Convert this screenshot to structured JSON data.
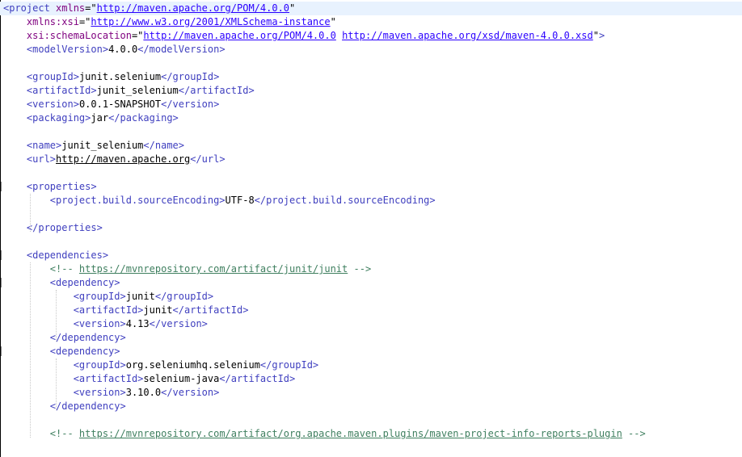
{
  "editor": {
    "colors": {
      "background": "#ffffff",
      "tag": "#3f3fbf",
      "attribute": "#7f007f",
      "attribute_value": "#2a00ff",
      "comment": "#3f7f5f",
      "current_line": "#e8f2fe"
    },
    "lines": [
      [
        {
          "t": "tag",
          "v": "<project"
        },
        {
          "t": "text",
          "v": " "
        },
        {
          "t": "attr",
          "v": "xmlns"
        },
        {
          "t": "punct",
          "v": "=\""
        },
        {
          "t": "url",
          "v": "http://maven.apache.org/POM/4.0.0"
        },
        {
          "t": "punct",
          "v": "\""
        }
      ],
      [
        {
          "t": "text",
          "v": "    "
        },
        {
          "t": "attr",
          "v": "xmlns:xsi"
        },
        {
          "t": "punct",
          "v": "=\""
        },
        {
          "t": "url",
          "v": "http://www.w3.org/2001/XMLSchema-instance"
        },
        {
          "t": "punct",
          "v": "\""
        }
      ],
      [
        {
          "t": "text",
          "v": "    "
        },
        {
          "t": "attr",
          "v": "xsi:schemaLocation"
        },
        {
          "t": "punct",
          "v": "=\""
        },
        {
          "t": "url",
          "v": "http://maven.apache.org/POM/4.0.0"
        },
        {
          "t": "text",
          "v": " "
        },
        {
          "t": "url",
          "v": "http://maven.apache.org/xsd/maven-4.0.0.xsd"
        },
        {
          "t": "punct",
          "v": "\""
        },
        {
          "t": "tag",
          "v": ">"
        }
      ],
      [
        {
          "t": "text",
          "v": "    "
        },
        {
          "t": "tag",
          "v": "<modelVersion>"
        },
        {
          "t": "text",
          "v": "4.0.0"
        },
        {
          "t": "tag",
          "v": "</modelVersion>"
        }
      ],
      [],
      [
        {
          "t": "text",
          "v": "    "
        },
        {
          "t": "tag",
          "v": "<groupId>"
        },
        {
          "t": "text",
          "v": "junit.selenium"
        },
        {
          "t": "tag",
          "v": "</groupId>"
        }
      ],
      [
        {
          "t": "text",
          "v": "    "
        },
        {
          "t": "tag",
          "v": "<artifactId>"
        },
        {
          "t": "text",
          "v": "junit_selenium"
        },
        {
          "t": "tag",
          "v": "</artifactId>"
        }
      ],
      [
        {
          "t": "text",
          "v": "    "
        },
        {
          "t": "tag",
          "v": "<version>"
        },
        {
          "t": "text",
          "v": "0.0.1-SNAPSHOT"
        },
        {
          "t": "tag",
          "v": "</version>"
        }
      ],
      [
        {
          "t": "text",
          "v": "    "
        },
        {
          "t": "tag",
          "v": "<packaging>"
        },
        {
          "t": "text",
          "v": "jar"
        },
        {
          "t": "tag",
          "v": "</packaging>"
        }
      ],
      [],
      [
        {
          "t": "text",
          "v": "    "
        },
        {
          "t": "tag",
          "v": "<name>"
        },
        {
          "t": "text",
          "v": "junit_selenium"
        },
        {
          "t": "tag",
          "v": "</name>"
        }
      ],
      [
        {
          "t": "text",
          "v": "    "
        },
        {
          "t": "tag",
          "v": "<url>"
        },
        {
          "t": "link",
          "v": "http://maven.apache.org"
        },
        {
          "t": "tag",
          "v": "</url>"
        }
      ],
      [],
      [
        {
          "t": "text",
          "v": "    "
        },
        {
          "t": "tag",
          "v": "<properties>"
        }
      ],
      [
        {
          "t": "text",
          "v": "        "
        },
        {
          "t": "tag",
          "v": "<project.build.sourceEncoding>"
        },
        {
          "t": "text",
          "v": "UTF-8"
        },
        {
          "t": "tag",
          "v": "</project.build.sourceEncoding>"
        }
      ],
      [],
      [
        {
          "t": "text",
          "v": "    "
        },
        {
          "t": "tag",
          "v": "</properties>"
        }
      ],
      [],
      [
        {
          "t": "text",
          "v": "    "
        },
        {
          "t": "tag",
          "v": "<dependencies>"
        }
      ],
      [
        {
          "t": "text",
          "v": "        "
        },
        {
          "t": "comment",
          "v": "<!-- "
        },
        {
          "t": "comment_link",
          "v": "https://mvnrepository.com/artifact/junit/junit"
        },
        {
          "t": "comment",
          "v": " -->"
        }
      ],
      [
        {
          "t": "text",
          "v": "        "
        },
        {
          "t": "tag",
          "v": "<dependency>"
        }
      ],
      [
        {
          "t": "text",
          "v": "            "
        },
        {
          "t": "tag",
          "v": "<groupId>"
        },
        {
          "t": "text",
          "v": "junit"
        },
        {
          "t": "tag",
          "v": "</groupId>"
        }
      ],
      [
        {
          "t": "text",
          "v": "            "
        },
        {
          "t": "tag",
          "v": "<artifactId>"
        },
        {
          "t": "text",
          "v": "junit"
        },
        {
          "t": "tag",
          "v": "</artifactId>"
        }
      ],
      [
        {
          "t": "text",
          "v": "            "
        },
        {
          "t": "tag",
          "v": "<version>"
        },
        {
          "t": "text",
          "v": "4.13"
        },
        {
          "t": "tag",
          "v": "</version>"
        }
      ],
      [
        {
          "t": "text",
          "v": "        "
        },
        {
          "t": "tag",
          "v": "</dependency>"
        }
      ],
      [
        {
          "t": "text",
          "v": "        "
        },
        {
          "t": "tag",
          "v": "<dependency>"
        }
      ],
      [
        {
          "t": "text",
          "v": "            "
        },
        {
          "t": "tag",
          "v": "<groupId>"
        },
        {
          "t": "text",
          "v": "org.seleniumhq.selenium"
        },
        {
          "t": "tag",
          "v": "</groupId>"
        }
      ],
      [
        {
          "t": "text",
          "v": "            "
        },
        {
          "t": "tag",
          "v": "<artifactId>"
        },
        {
          "t": "text",
          "v": "selenium-java"
        },
        {
          "t": "tag",
          "v": "</artifactId>"
        }
      ],
      [
        {
          "t": "text",
          "v": "            "
        },
        {
          "t": "tag",
          "v": "<version>"
        },
        {
          "t": "text",
          "v": "3.10.0"
        },
        {
          "t": "tag",
          "v": "</version>"
        }
      ],
      [
        {
          "t": "text",
          "v": "        "
        },
        {
          "t": "tag",
          "v": "</dependency>"
        }
      ],
      [],
      [
        {
          "t": "text",
          "v": "        "
        },
        {
          "t": "comment",
          "v": "<!-- "
        },
        {
          "t": "comment_link",
          "v": "https://mvnrepository.com/artifact/org.apache.maven.plugins/maven-project-info-reports-plugin"
        },
        {
          "t": "comment",
          "v": " -->"
        }
      ]
    ]
  }
}
